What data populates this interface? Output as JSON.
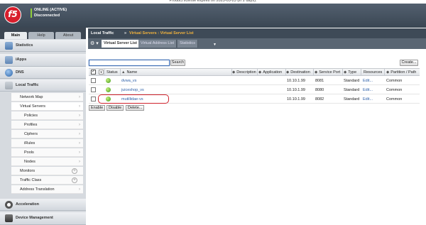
{
  "banner": {
    "text": "Product license expires on 2025-05-23 (in 2 days)."
  },
  "header": {
    "logo_text": "f5",
    "status_online": "ONLINE (ACTIVE)",
    "status_connection": "Disconnected",
    "status_color": "#8fcb3a"
  },
  "left_tabs": {
    "main": "Main",
    "help": "Help",
    "about": "About"
  },
  "nav": {
    "sections": [
      {
        "label": "Statistics",
        "icon": "statistics-icon",
        "color": "#5e88b8"
      },
      {
        "label": "iApps",
        "icon": "iapps-icon",
        "color": "#6b8fb5"
      },
      {
        "label": "DNS",
        "icon": "dns-globe-icon",
        "color": "#3d73b0"
      },
      {
        "label": "Local Traffic",
        "icon": "local-traffic-icon",
        "color": "#8b949e"
      }
    ],
    "local_traffic_items": [
      {
        "label": "Network Map"
      },
      {
        "label": "Virtual Servers"
      },
      {
        "label": "Policies"
      },
      {
        "label": "Profiles"
      },
      {
        "label": "Ciphers"
      },
      {
        "label": "iRules"
      },
      {
        "label": "Pools"
      },
      {
        "label": "Nodes"
      },
      {
        "label": "Monitors"
      },
      {
        "label": "Traffic Class"
      },
      {
        "label": "Address Translation"
      }
    ],
    "bottom_sections": [
      {
        "label": "Acceleration",
        "icon": "acceleration-gauge-icon"
      },
      {
        "label": "Device Management",
        "icon": "device-management-icon"
      }
    ]
  },
  "breadcrumb": {
    "part1": "Local Traffic",
    "separator": "»",
    "part2": "Virtual Servers : Virtual Server List"
  },
  "subtabs": {
    "gear": "⚙ ▾",
    "items": [
      "Virtual Server List",
      "Virtual Address List",
      "Statistics"
    ]
  },
  "search": {
    "button": "Search",
    "value": ""
  },
  "create_button": "Create...",
  "table": {
    "headers": {
      "status": "Status",
      "name": "Name",
      "description": "Description",
      "application": "Application",
      "destination": "Destination",
      "service_port": "Service Port",
      "type": "Type",
      "resources": "Resources",
      "partition": "Partition / Path"
    },
    "rows": [
      {
        "name": "dvwa_vs",
        "destination": "10.10.1.99",
        "port": "8081",
        "type": "Standard",
        "resources": "Edit...",
        "partition": "Common"
      },
      {
        "name": "juiceshop_vs",
        "destination": "10.10.1.99",
        "port": "8080",
        "type": "Standard",
        "resources": "Edit...",
        "partition": "Common"
      },
      {
        "name": "mutillidae-vs",
        "destination": "10.10.1.99",
        "port": "8082",
        "type": "Standard",
        "resources": "Edit...",
        "partition": "Common"
      }
    ]
  },
  "actions": {
    "enable": "Enable",
    "disable": "Disable",
    "delete": "Delete..."
  }
}
